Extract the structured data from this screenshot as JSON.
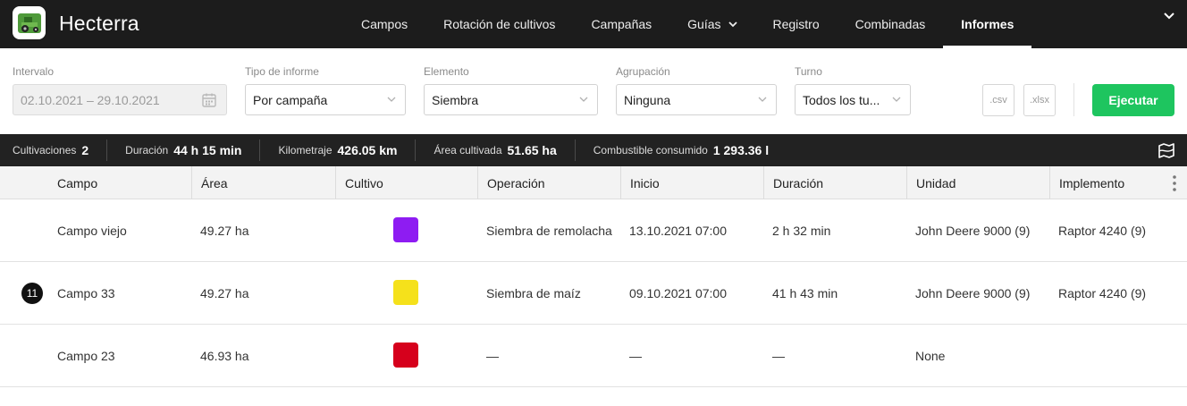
{
  "app": {
    "brand": "Hecterra"
  },
  "nav": {
    "items": [
      {
        "label": "Campos",
        "active": false
      },
      {
        "label": "Rotación de cultivos",
        "active": false
      },
      {
        "label": "Campañas",
        "active": false
      },
      {
        "label": "Guías",
        "active": false,
        "has_dropdown": true
      },
      {
        "label": "Registro",
        "active": false
      },
      {
        "label": "Combinadas",
        "active": false
      },
      {
        "label": "Informes",
        "active": true
      }
    ]
  },
  "filters": {
    "interval": {
      "label": "Intervalo",
      "value": "02.10.2021 – 29.10.2021",
      "disabled": true
    },
    "report_type": {
      "label": "Tipo de informe",
      "value": "Por campaña"
    },
    "element": {
      "label": "Elemento",
      "value": "Siembra"
    },
    "grouping": {
      "label": "Agrupación",
      "value": "Ninguna"
    },
    "shift": {
      "label": "Turno",
      "value": "Todos los tu..."
    }
  },
  "export": {
    "csv_label": ".csv",
    "xlsx_label": ".xlsx"
  },
  "run_button": {
    "label": "Ejecutar",
    "color": "#1ec55f"
  },
  "summary": {
    "items": [
      {
        "label": "Cultivaciones",
        "value": "2"
      },
      {
        "label": "Duración",
        "value": "44 h 15 min"
      },
      {
        "label": "Kilometraje",
        "value": "426.05 km"
      },
      {
        "label": "Área cultivada",
        "value": "51.65 ha"
      },
      {
        "label": "Combustible consumido",
        "value": "1 293.36 l"
      }
    ]
  },
  "table": {
    "columns": [
      "Campo",
      "Área",
      "Cultivo",
      "Operación",
      "Inicio",
      "Duración",
      "Unidad",
      "Implemento"
    ],
    "rows": [
      {
        "badge": "",
        "campo": "Campo viejo",
        "area": "49.27 ha",
        "crop_color": "#8e1cf2",
        "operacion": "Siembra de remolacha",
        "inicio": "13.10.2021 07:00",
        "duracion": "2 h 32 min",
        "unidad": "John Deere 9000 (9)",
        "implemento": "Raptor 4240 (9)"
      },
      {
        "badge": "11",
        "campo": "Campo 33",
        "area": "49.27 ha",
        "crop_color": "#f5e11b",
        "operacion": "Siembra de maíz",
        "inicio": "09.10.2021 07:00",
        "duracion": "41 h 43 min",
        "unidad": "John Deere 9000 (9)",
        "implemento": "Raptor 4240 (9)"
      },
      {
        "badge": "",
        "campo": "Campo 23",
        "area": "46.93 ha",
        "crop_color": "#d6001c",
        "operacion": "—",
        "inicio": "—",
        "duracion": "—",
        "unidad": "None",
        "implemento": ""
      }
    ]
  },
  "icons": {
    "logo": "tractor-logo-icon",
    "calendar": "calendar-icon",
    "caret": "chevron-down-icon",
    "map": "map-icon",
    "more": "more-vertical-icon"
  }
}
